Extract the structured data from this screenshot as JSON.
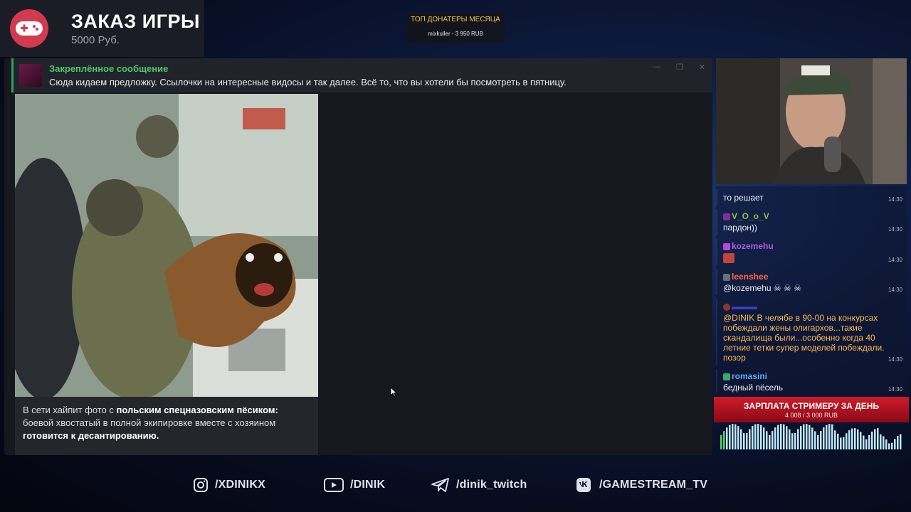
{
  "order": {
    "title": "ЗАКАЗ ИГРЫ",
    "price": "5000 Руб."
  },
  "top_donators": {
    "title": "ТОП ДОНАТЕРЫ МЕСЯЦА",
    "entry": "mixkuller - 3 950 RUB"
  },
  "telegram": {
    "pinned_title": "Закреплённое сообщение",
    "pinned_body": "Сюда кидаем предложку. Ссылочки на интересные видосы и так далее. Всё то, что вы хотели бы посмотреть в пятницу.",
    "post_text_1": "В сети хайпит фото с ",
    "post_text_bold_1": "польским спецназовским пёсиком:",
    "post_text_2": " боевой хвостатый в полной экипировке вместе с хозяином ",
    "post_text_bold_2": "готовится к десантированию."
  },
  "chat": {
    "messages": [
      {
        "name": "",
        "body": "то решает",
        "time": "14:30",
        "color": "#ffffff"
      },
      {
        "name": "V_O_o_V",
        "body": "пардон))",
        "time": "14:30",
        "color": "#8fbf3f"
      },
      {
        "name": "kozemehu",
        "body": "",
        "time": "14:30",
        "color": "#b05de0"
      },
      {
        "name": "leenshee",
        "body": "@kozemehu",
        "time": "14:30",
        "color": "#ff6a3c"
      },
      {
        "name": "",
        "body": "@DINIK В челябе в 90-00 на конкурсах побеждали жены олигархов...такие скандалища были...особенно когда 40 летние тетки супер моделей побеждали. позор",
        "time": "14:30",
        "color": "#ffb84a"
      },
      {
        "name": "romasini",
        "body": "бедный пёсель",
        "time": "14:30",
        "color": "#5fa8ff"
      }
    ]
  },
  "salary": {
    "title": "ЗАРПЛАТА СТРИМЕРУ ЗА ДЕНЬ",
    "value": "4 008 / 3 000 RUB"
  },
  "socials": [
    {
      "icon": "instagram-icon",
      "label": "/XDINIKX"
    },
    {
      "icon": "youtube-icon",
      "label": "/DINIK"
    },
    {
      "icon": "telegram-icon",
      "label": "/dinik_twitch"
    },
    {
      "icon": "vk-icon",
      "label": "/GAMESTREAM_TV"
    }
  ]
}
